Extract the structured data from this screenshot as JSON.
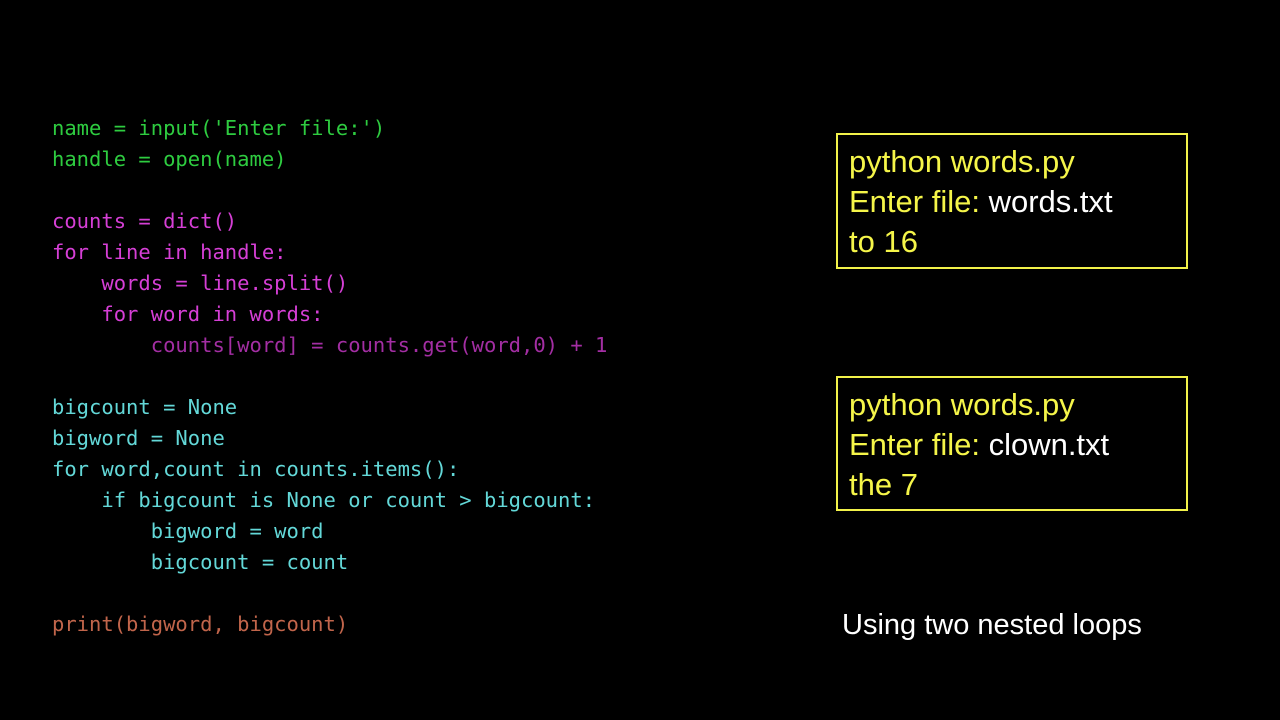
{
  "slide": {
    "background_color": "#000000",
    "caption": "Using two nested loops"
  },
  "code": {
    "font": "monospace",
    "colors": {
      "green": "#2ecc40",
      "magenta": "#d63fd6",
      "magenta_dim": "#a32ea3",
      "cyan": "#63d8d8",
      "salmon": "#c1654b"
    },
    "lines": [
      {
        "text": "name = input('Enter file:')",
        "color": "#2ecc40"
      },
      {
        "text": "handle = open(name)",
        "color": "#2ecc40"
      },
      {
        "text": "",
        "color": "#2ecc40"
      },
      {
        "text": "counts = dict()",
        "color": "#d63fd6"
      },
      {
        "text": "for line in handle:",
        "color": "#d63fd6"
      },
      {
        "text": "    words = line.split()",
        "color": "#d63fd6"
      },
      {
        "text": "    for word in words:",
        "color": "#d63fd6"
      },
      {
        "text": "        counts[word] = counts.get(word,0) + 1",
        "color": "#a32ea3"
      },
      {
        "text": "",
        "color": "#a32ea3"
      },
      {
        "text": "bigcount = None",
        "color": "#63d8d8"
      },
      {
        "text": "bigword = None",
        "color": "#63d8d8"
      },
      {
        "text": "for word,count in counts.items():",
        "color": "#63d8d8"
      },
      {
        "text": "    if bigcount is None or count > bigcount:",
        "color": "#63d8d8"
      },
      {
        "text": "        bigword = word",
        "color": "#63d8d8"
      },
      {
        "text": "        bigcount = count",
        "color": "#63d8d8"
      },
      {
        "text": "",
        "color": "#63d8d8"
      },
      {
        "text": "print(bigword, bigcount)",
        "color": "#c1654b"
      }
    ]
  },
  "output_boxes": [
    {
      "border_color": "#f2f24a",
      "text_color": "#f5f549",
      "command": "python words.py",
      "prompt": "Enter file: ",
      "filename": "words.txt",
      "result": "to 16"
    },
    {
      "border_color": "#f2f24a",
      "text_color": "#f5f549",
      "command": "python words.py",
      "prompt": "Enter file: ",
      "filename": "clown.txt",
      "result": "the 7"
    }
  ]
}
